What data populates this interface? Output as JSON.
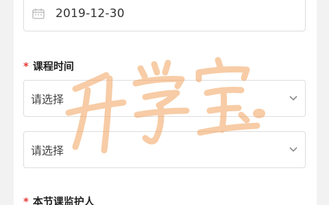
{
  "date_field": {
    "value": "2019-12-30",
    "icon": "calendar-icon"
  },
  "course_time": {
    "required_mark": "*",
    "label": "课程时间",
    "start_select": {
      "value": "请选择",
      "icon": "chevron-down-icon"
    },
    "end_select": {
      "value": "请选择",
      "icon": "chevron-down-icon"
    }
  },
  "supervisor": {
    "required_mark": "*",
    "label": "本节课监护人"
  },
  "watermark": {
    "text": "升学宝",
    "color": "#f2a35e"
  }
}
